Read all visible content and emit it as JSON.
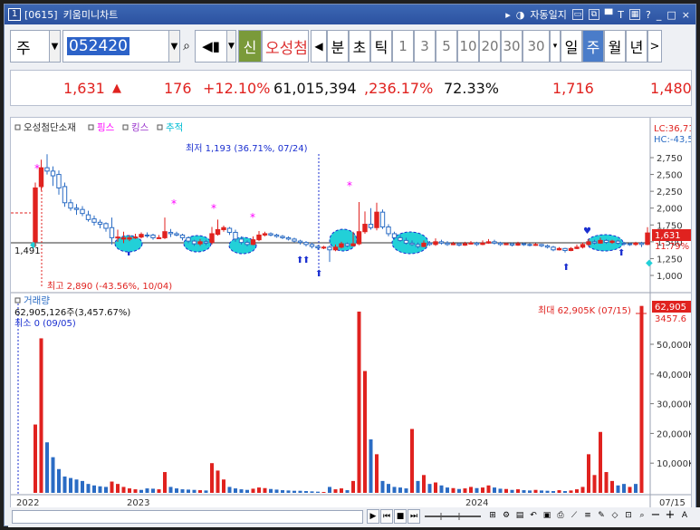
{
  "window": {
    "num": "1",
    "code": "[0615]",
    "title": "키움미니차트",
    "auto_label": "자동일지",
    "icons": [
      "restore-icon",
      "float-icon",
      "pin-icon",
      "text-icon",
      "grid-icon",
      "help-icon"
    ],
    "help": "?",
    "minimize": "_",
    "maximize": "□",
    "close": "×"
  },
  "toolbar": {
    "market": "주",
    "code": "052420",
    "shin": "신",
    "stock_name": "오성첨",
    "buttons": [
      "분",
      "초",
      "틱"
    ],
    "periods": [
      "1",
      "3",
      "5",
      "10",
      "20",
      "30"
    ],
    "period_select": "30",
    "tabs": [
      "일",
      "주",
      "월",
      "년"
    ],
    "selected_tab": "주",
    "prev": "◀",
    "next": ">"
  },
  "quote": {
    "price": "1,631",
    "arrow": "▲",
    "change": "176",
    "change_pct": "+12.10%",
    "volume": "61,015,394",
    "volume_pct": ",236.17%",
    "turnover": "72.33%",
    "high": "1,716",
    "low": "1,480",
    "colors": {
      "up": "#e0221f",
      "neutral": "#111111"
    }
  },
  "chart_data": {
    "type": "candlestick",
    "legend": [
      {
        "label": "오성첨단소재",
        "color": "#333333"
      },
      {
        "label": "핑스",
        "color": "#ff00ff"
      },
      {
        "label": "킹스",
        "color": "#9933cc"
      },
      {
        "label": "추적",
        "color": "#00bcd4"
      }
    ],
    "price_axis": [
      "2,750",
      "2,500",
      "2,250",
      "2,000",
      "1,750",
      "1,500",
      "1,250",
      "1,000"
    ],
    "price_ylim": [
      850,
      2900
    ],
    "lc": "LC:36,71",
    "hc": "HC:-43,5",
    "left_ref": "1,491",
    "current_price": "1,631",
    "current_pct": "11.79%",
    "low_note": "최저 1,193 (36.71%, 07/24)",
    "high_note": "최고 2,890 (-43.56%, 10/04)",
    "candles": [
      [
        1500,
        2300,
        1420,
        2380,
        1
      ],
      [
        2320,
        2600,
        2260,
        2720,
        1
      ],
      [
        2600,
        2550,
        2500,
        2800,
        0
      ],
      [
        2550,
        2480,
        2330,
        2620,
        0
      ],
      [
        2500,
        2300,
        2200,
        2560,
        0
      ],
      [
        2320,
        2080,
        2020,
        2380,
        0
      ],
      [
        2080,
        2000,
        1960,
        2130,
        0
      ],
      [
        2000,
        1980,
        1900,
        2060,
        0
      ],
      [
        1980,
        1920,
        1880,
        2030,
        0
      ],
      [
        1900,
        1830,
        1800,
        1960,
        0
      ],
      [
        1840,
        1790,
        1740,
        1890,
        0
      ],
      [
        1790,
        1760,
        1700,
        1830,
        0
      ],
      [
        1770,
        1700,
        1650,
        1790,
        0
      ],
      [
        1710,
        1560,
        1460,
        1860,
        0
      ],
      [
        1570,
        1560,
        1500,
        1680,
        1
      ],
      [
        1560,
        1540,
        1480,
        1650,
        1
      ],
      [
        1540,
        1560,
        1510,
        1600,
        1
      ],
      [
        1570,
        1570,
        1540,
        1620,
        1
      ],
      [
        1570,
        1610,
        1550,
        1640,
        1
      ],
      [
        1600,
        1600,
        1560,
        1640,
        0
      ],
      [
        1600,
        1560,
        1530,
        1620,
        0
      ],
      [
        1560,
        1560,
        1540,
        1600,
        1
      ],
      [
        1560,
        1650,
        1540,
        1860,
        1
      ],
      [
        1640,
        1620,
        1570,
        1690,
        0
      ],
      [
        1620,
        1600,
        1580,
        1650,
        0
      ],
      [
        1600,
        1560,
        1520,
        1620,
        0
      ],
      [
        1560,
        1510,
        1480,
        1580,
        0
      ],
      [
        1510,
        1470,
        1440,
        1530,
        0
      ],
      [
        1470,
        1500,
        1440,
        1540,
        1
      ],
      [
        1500,
        1480,
        1450,
        1530,
        0
      ],
      [
        1490,
        1620,
        1460,
        1720,
        1
      ],
      [
        1610,
        1680,
        1590,
        1830,
        1
      ],
      [
        1680,
        1710,
        1650,
        1740,
        1
      ],
      [
        1700,
        1640,
        1600,
        1720,
        0
      ],
      [
        1640,
        1540,
        1500,
        1680,
        0
      ],
      [
        1540,
        1490,
        1460,
        1580,
        0
      ],
      [
        1490,
        1460,
        1430,
        1520,
        0
      ],
      [
        1460,
        1530,
        1450,
        1580,
        1
      ],
      [
        1530,
        1600,
        1510,
        1660,
        1
      ],
      [
        1600,
        1620,
        1580,
        1650,
        1
      ],
      [
        1620,
        1600,
        1580,
        1640,
        0
      ],
      [
        1600,
        1580,
        1560,
        1620,
        0
      ],
      [
        1580,
        1560,
        1540,
        1600,
        0
      ],
      [
        1560,
        1540,
        1520,
        1580,
        0
      ],
      [
        1540,
        1510,
        1490,
        1560,
        0
      ],
      [
        1510,
        1490,
        1460,
        1530,
        0
      ],
      [
        1490,
        1460,
        1430,
        1510,
        0
      ],
      [
        1460,
        1430,
        1400,
        1490,
        0
      ],
      [
        1430,
        1410,
        1380,
        1450,
        0
      ],
      [
        1410,
        1420,
        1390,
        1440,
        1
      ],
      [
        1420,
        1380,
        1200,
        1450,
        0
      ],
      [
        1380,
        1420,
        1360,
        1460,
        1
      ],
      [
        1420,
        1470,
        1400,
        1500,
        1
      ],
      [
        1470,
        1440,
        1420,
        1490,
        0
      ],
      [
        1440,
        1470,
        1430,
        1650,
        1
      ],
      [
        1470,
        1650,
        1450,
        2090,
        1
      ],
      [
        1650,
        1760,
        1620,
        1950,
        1
      ],
      [
        1760,
        1710,
        1680,
        2000,
        0
      ],
      [
        1710,
        1940,
        1670,
        2080,
        1
      ],
      [
        1940,
        1720,
        1690,
        1980,
        0
      ],
      [
        1720,
        1620,
        1580,
        1760,
        0
      ],
      [
        1620,
        1560,
        1530,
        1650,
        0
      ],
      [
        1560,
        1520,
        1500,
        1600,
        0
      ],
      [
        1520,
        1480,
        1460,
        1560,
        0
      ],
      [
        1480,
        1460,
        1440,
        1520,
        0
      ],
      [
        1460,
        1430,
        1400,
        1490,
        0
      ],
      [
        1430,
        1480,
        1420,
        1520,
        1
      ],
      [
        1480,
        1460,
        1440,
        1510,
        0
      ],
      [
        1460,
        1500,
        1440,
        1550,
        1
      ],
      [
        1500,
        1480,
        1460,
        1530,
        0
      ],
      [
        1480,
        1460,
        1440,
        1510,
        0
      ],
      [
        1460,
        1470,
        1450,
        1500,
        1
      ],
      [
        1470,
        1450,
        1430,
        1490,
        0
      ],
      [
        1450,
        1470,
        1440,
        1500,
        1
      ],
      [
        1470,
        1480,
        1460,
        1510,
        1
      ],
      [
        1480,
        1460,
        1440,
        1500,
        0
      ],
      [
        1460,
        1480,
        1450,
        1520,
        1
      ],
      [
        1480,
        1500,
        1470,
        1540,
        1
      ],
      [
        1500,
        1480,
        1460,
        1530,
        0
      ],
      [
        1480,
        1460,
        1440,
        1500,
        0
      ],
      [
        1460,
        1470,
        1450,
        1490,
        1
      ],
      [
        1470,
        1450,
        1430,
        1490,
        0
      ],
      [
        1450,
        1470,
        1440,
        1500,
        1
      ],
      [
        1470,
        1460,
        1440,
        1490,
        0
      ],
      [
        1460,
        1450,
        1430,
        1480,
        0
      ],
      [
        1450,
        1460,
        1440,
        1480,
        1
      ],
      [
        1460,
        1440,
        1420,
        1470,
        0
      ],
      [
        1440,
        1420,
        1400,
        1460,
        0
      ],
      [
        1420,
        1380,
        1360,
        1440,
        0
      ],
      [
        1380,
        1400,
        1370,
        1420,
        1
      ],
      [
        1400,
        1370,
        1340,
        1410,
        0
      ],
      [
        1370,
        1400,
        1360,
        1420,
        1
      ],
      [
        1400,
        1420,
        1390,
        1460,
        1
      ],
      [
        1420,
        1460,
        1400,
        1490,
        1
      ],
      [
        1460,
        1500,
        1440,
        1540,
        1
      ],
      [
        1500,
        1480,
        1460,
        1530,
        0
      ],
      [
        1480,
        1520,
        1470,
        1560,
        1
      ],
      [
        1520,
        1490,
        1470,
        1540,
        0
      ],
      [
        1490,
        1510,
        1470,
        1530,
        1
      ],
      [
        1510,
        1480,
        1460,
        1530,
        0
      ],
      [
        1480,
        1470,
        1440,
        1500,
        0
      ],
      [
        1470,
        1460,
        1440,
        1490,
        0
      ],
      [
        1460,
        1480,
        1440,
        1500,
        1
      ],
      [
        1480,
        1460,
        1420,
        1500,
        0
      ],
      [
        1460,
        1631,
        1450,
        1716,
        1
      ]
    ],
    "volume_axis": [
      "50,000K",
      "40,000K",
      "30,000K",
      "20,000K",
      "10,000K"
    ],
    "volume_ylim": [
      0,
      65000
    ],
    "volume_title": "거래량",
    "volume_stat": "62,905,126주(3,457.67%)",
    "volume_min_note": "최소 0 (09/05)",
    "volume_max_note": "최대 62,905K (07/15)",
    "volume_current": "62,905",
    "volume_pct": "3457.6",
    "volumes": [
      [
        23000,
        1
      ],
      [
        52000,
        1
      ],
      [
        17000,
        0
      ],
      [
        12000,
        0
      ],
      [
        8000,
        0
      ],
      [
        5500,
        0
      ],
      [
        5000,
        0
      ],
      [
        4500,
        0
      ],
      [
        4000,
        0
      ],
      [
        3000,
        0
      ],
      [
        2500,
        0
      ],
      [
        2200,
        0
      ],
      [
        2000,
        0
      ],
      [
        3800,
        1
      ],
      [
        3000,
        1
      ],
      [
        2000,
        1
      ],
      [
        1500,
        1
      ],
      [
        1200,
        1
      ],
      [
        1000,
        0
      ],
      [
        1500,
        0
      ],
      [
        1400,
        0
      ],
      [
        1200,
        1
      ],
      [
        7000,
        1
      ],
      [
        2000,
        0
      ],
      [
        1500,
        0
      ],
      [
        1200,
        0
      ],
      [
        1100,
        0
      ],
      [
        1000,
        0
      ],
      [
        900,
        1
      ],
      [
        800,
        0
      ],
      [
        10000,
        1
      ],
      [
        7500,
        1
      ],
      [
        4500,
        1
      ],
      [
        2000,
        0
      ],
      [
        1500,
        0
      ],
      [
        1200,
        0
      ],
      [
        1000,
        0
      ],
      [
        1400,
        1
      ],
      [
        1800,
        1
      ],
      [
        1600,
        1
      ],
      [
        1300,
        0
      ],
      [
        1100,
        0
      ],
      [
        900,
        0
      ],
      [
        800,
        0
      ],
      [
        700,
        0
      ],
      [
        700,
        0
      ],
      [
        600,
        0
      ],
      [
        500,
        0
      ],
      [
        400,
        0
      ],
      [
        300,
        1
      ],
      [
        2000,
        0
      ],
      [
        1200,
        1
      ],
      [
        1500,
        1
      ],
      [
        900,
        0
      ],
      [
        4000,
        1
      ],
      [
        61000,
        1
      ],
      [
        41000,
        1
      ],
      [
        18000,
        0
      ],
      [
        13000,
        1
      ],
      [
        4000,
        0
      ],
      [
        3000,
        0
      ],
      [
        2000,
        0
      ],
      [
        1800,
        0
      ],
      [
        1500,
        0
      ],
      [
        21500,
        1
      ],
      [
        4000,
        0
      ],
      [
        6000,
        1
      ],
      [
        3000,
        0
      ],
      [
        3500,
        1
      ],
      [
        2500,
        0
      ],
      [
        1800,
        0
      ],
      [
        1600,
        1
      ],
      [
        1300,
        0
      ],
      [
        1500,
        1
      ],
      [
        2000,
        1
      ],
      [
        1600,
        0
      ],
      [
        1800,
        1
      ],
      [
        2500,
        1
      ],
      [
        1800,
        0
      ],
      [
        1400,
        0
      ],
      [
        1300,
        1
      ],
      [
        1000,
        0
      ],
      [
        1200,
        1
      ],
      [
        900,
        0
      ],
      [
        800,
        0
      ],
      [
        1000,
        1
      ],
      [
        800,
        0
      ],
      [
        700,
        0
      ],
      [
        600,
        0
      ],
      [
        900,
        1
      ],
      [
        600,
        0
      ],
      [
        800,
        1
      ],
      [
        1200,
        1
      ],
      [
        2000,
        1
      ],
      [
        13000,
        1
      ],
      [
        6000,
        1
      ],
      [
        20500,
        1
      ],
      [
        7000,
        1
      ],
      [
        4000,
        1
      ],
      [
        2500,
        0
      ],
      [
        3000,
        0
      ],
      [
        2000,
        1
      ],
      [
        3000,
        0
      ],
      [
        62905,
        1
      ]
    ],
    "x_ticks": [
      "2022",
      "2023",
      "2024"
    ],
    "x_end_label": "07/15",
    "colors": {
      "up": "#e0221f",
      "down": "#2b6cc4",
      "ma": "#4a8ad6",
      "highlight": "#22d0d8"
    }
  }
}
